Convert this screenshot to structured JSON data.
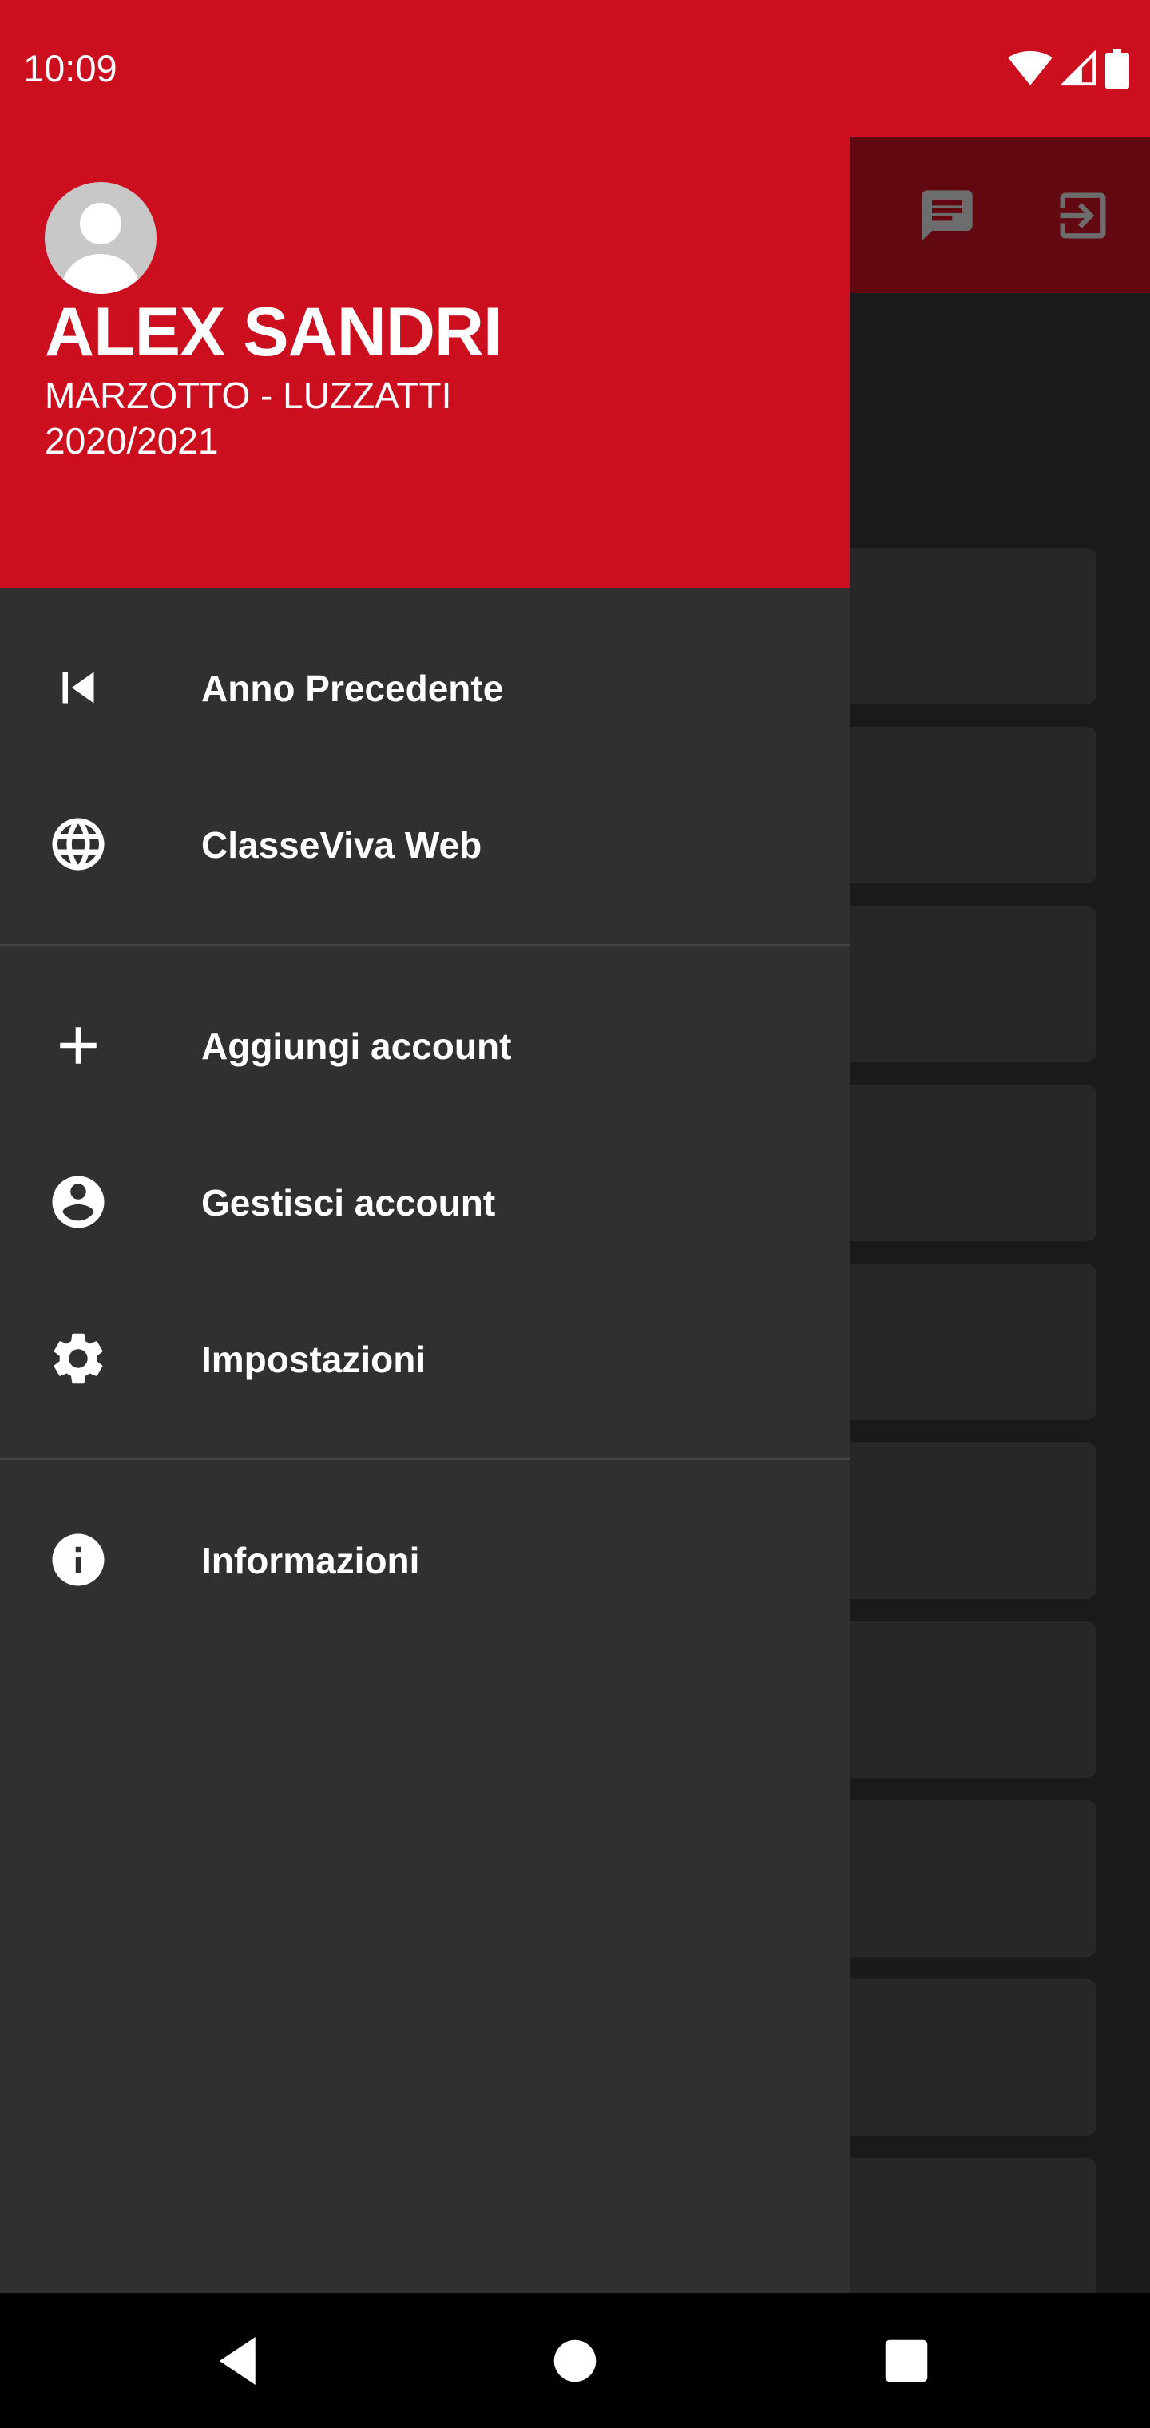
{
  "status_bar": {
    "time": "10:09",
    "icons": [
      "wifi-icon",
      "cellular-signal-icon",
      "battery-icon"
    ]
  },
  "toolbar": {
    "icons": [
      "message-icon",
      "logout-icon"
    ]
  },
  "drawer": {
    "header": {
      "name": "ALEX SANDRI",
      "school": "MARZOTTO - LUZZATTI",
      "year": "2020/2021"
    },
    "sections": [
      [
        {
          "label": "Anno Precedente",
          "icon": "skip-previous-icon"
        },
        {
          "label": "ClasseViva Web",
          "icon": "globe-icon"
        }
      ],
      [
        {
          "label": "Aggiungi account",
          "icon": "plus-icon"
        },
        {
          "label": "Gestisci account",
          "icon": "account-circle-icon"
        },
        {
          "label": "Impostazioni",
          "icon": "gear-icon"
        }
      ],
      [
        {
          "label": "Informazioni",
          "icon": "info-icon"
        }
      ]
    ]
  },
  "colors": {
    "header": "#cc0f1f",
    "drawer": "#303030",
    "scrim_toolbar": "#610811"
  },
  "nav_bar": {
    "buttons": [
      "back-icon",
      "home-icon",
      "recents-icon"
    ]
  }
}
